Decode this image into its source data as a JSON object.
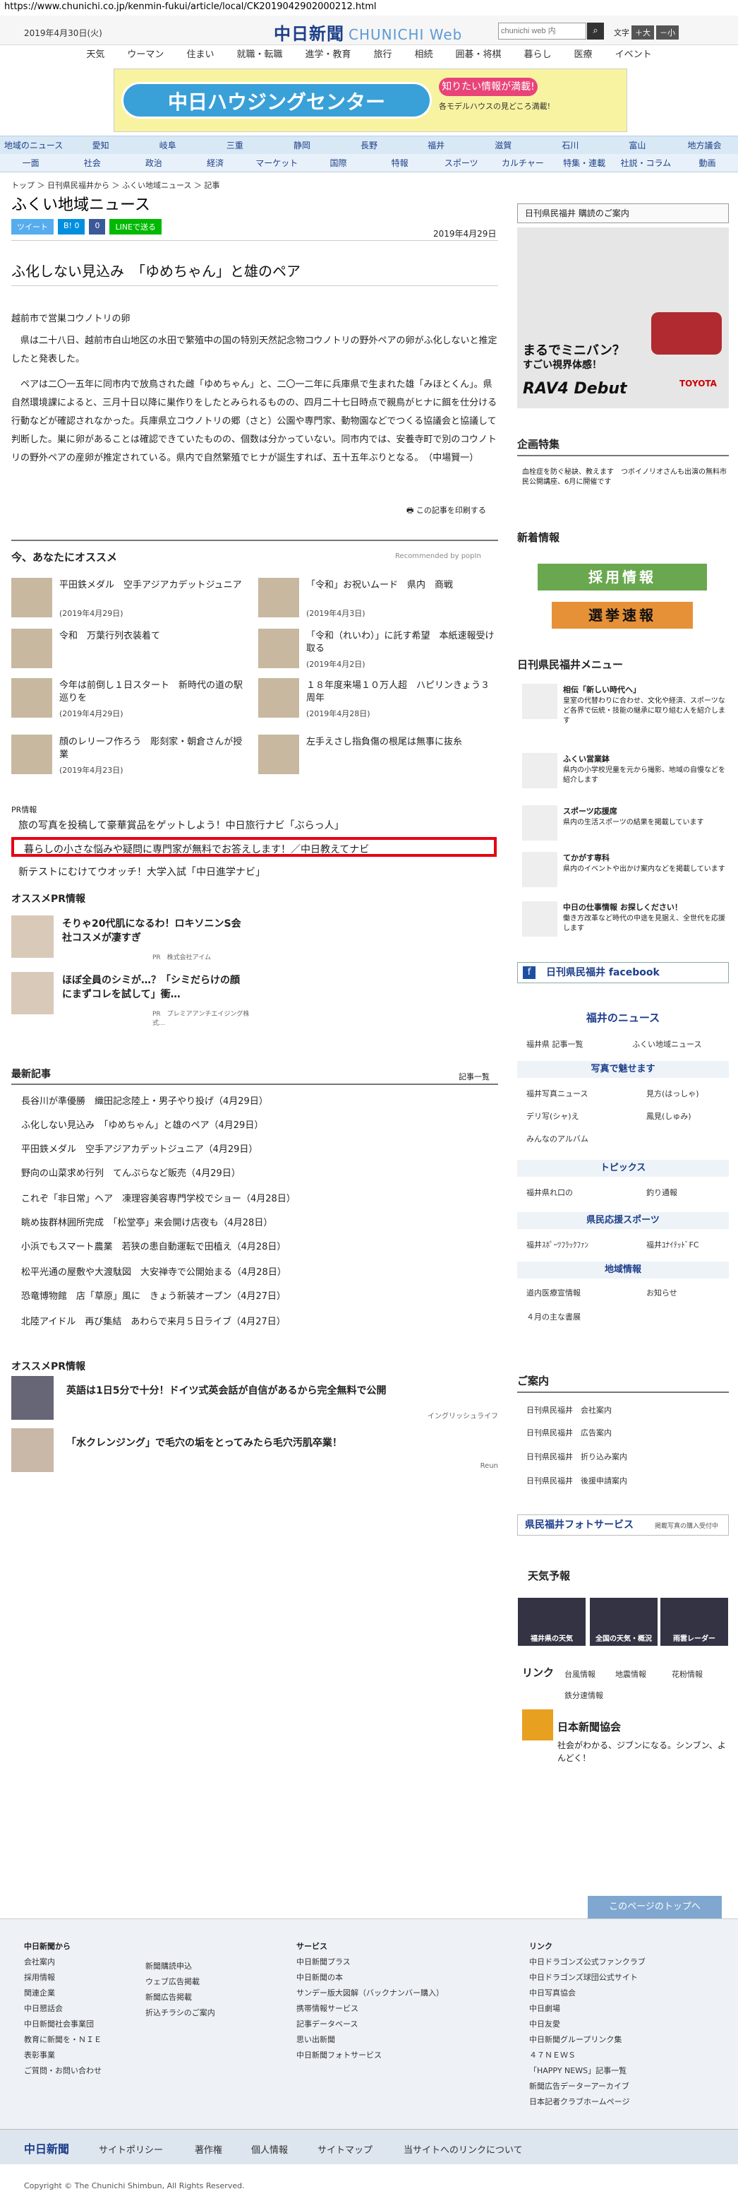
{
  "url": "https://www.chunichi.co.jp/kenmin-fukui/article/local/CK2019042902000212.html",
  "header": {
    "date": "2019年4月30日(火)",
    "logo_main": "中日新聞",
    "logo_sub": "CHUNICHI Web",
    "search_placeholder": "chunichi web 内",
    "font_label": "文字",
    "font_plus": "＋大",
    "font_minus": "－小"
  },
  "topnav": [
    "天気",
    "ウーマン",
    "住まい",
    "就職・転職",
    "進学・教育",
    "旅行",
    "相続",
    "囲碁・将棋",
    "暮らし",
    "医療",
    "イベント"
  ],
  "banner": {
    "title": "中日ハウジングセンター",
    "badge": "知りたい情報が満載!",
    "sub": "各モデルハウスの見どころ満載!"
  },
  "regions": [
    "地域のニュース",
    "愛知",
    "岐阜",
    "三重",
    "静岡",
    "長野",
    "福井",
    "滋賀",
    "石川",
    "富山",
    "地方議会"
  ],
  "categories": [
    "一面",
    "社会",
    "政治",
    "経済",
    "マーケット",
    "国際",
    "特報",
    "スポーツ",
    "カルチャー",
    "特集・連載",
    "社説・コラム",
    "動画"
  ],
  "breadcrumb": "トップ ＞ 日刊県民福井から ＞ ふくい地域ニュース ＞ 記事",
  "section_title": "ふくい地域ニュース",
  "share": {
    "tweet": "ツイート",
    "hatena": "B! 0",
    "fb": "0",
    "line": "LINEで送る"
  },
  "published": "2019年4月29日",
  "headline": "ふ化しない見込み　「ゆめちゃん」と雄のペア",
  "byline": "越前市で営巣コウノトリの卵",
  "body": [
    "県は二十八日、越前市白山地区の水田で繁殖中の国の特別天然記念物コウノトリの野外ペアの卵がふ化しないと推定したと発表した。",
    "ペアは二〇一五年に同市内で放鳥された雌「ゆめちゃん」と、二〇一二年に兵庫県で生まれた雄「みほとくん」。県自然環境課によると、三月十日以降に巣作りをしたとみられるものの、四月二十七日時点で親鳥がヒナに餌を仕分ける行動などが確認されなかった。兵庫県立コウノトリの郷（さと）公園や専門家、動物園などでつくる協議会と協議して判断した。巣に卵があることは確認できていたものの、個数は分かっていない。同市内では、安養寺町で別のコウノトリの野外ペアの産卵が推定されている。県内で自然繁殖でヒナが誕生すれば、五十五年ぶりとなる。　（中場賢一）"
  ],
  "print_link": "この記事を印刷する",
  "reco": {
    "heading": "今、あなたにオススメ",
    "powered": "Recommended by popIn",
    "items": [
      {
        "title": "平田鉄メダル　空手アジアカデットジュニア",
        "date": "(2019年4月29日)"
      },
      {
        "title": "「令和」お祝いムード　県内　商戦",
        "date": "(2019年4月3日)"
      },
      {
        "title": "令和　万葉行列衣装着て",
        "date": ""
      },
      {
        "title": "「令和（れいわ）」に託す希望　本紙速報受け取る",
        "date": "(2019年4月2日)"
      },
      {
        "title": "今年は前倒し１日スタート　新時代の道の駅巡りを",
        "date": "(2019年4月29日)"
      },
      {
        "title": "１８年度来場１０万人超　ハピリンきょう３周年",
        "date": "(2019年4月28日)"
      },
      {
        "title": "顔のレリーフ作ろう　彫刻家・朝倉さんが授業",
        "date": "(2019年4月23日)"
      },
      {
        "title": "左手えさし指負傷の根尾は無事に抜糸",
        "date": ""
      }
    ]
  },
  "pr": {
    "label": "PR情報",
    "items": [
      "旅の写真を投稿して豪華賞品をゲットしよう！中日旅行ナビ「ぶらっ人」",
      "暮らしの小さな悩みや疑問に専門家が無料でお答えします！／中日教えてナビ",
      "新テストにむけてウオッチ！大学入試「中日進学ナビ」"
    ]
  },
  "pr2": {
    "heading": "オススメPR情報",
    "items": [
      {
        "title": "そりゃ20代肌になるわ！ロキソニンS会社コスメが凄すぎ",
        "src": "PR　株式会社アイム"
      },
      {
        "title": "ほぼ全員のシミが…？「シミだらけの顔にまずコレを試して」衝…",
        "src": "PR　プレミアアンチエイジング株式…"
      }
    ]
  },
  "latest": {
    "heading": "最新記事",
    "all": "記事一覧",
    "items": [
      "長谷川が準優勝　織田記念陸上・男子やり投げ（4月29日）",
      "ふ化しない見込み　「ゆめちゃん」と雄のペア（4月29日）",
      "平田鉄メダル　空手アジアカデットジュニア（4月29日）",
      "野向の山菜求め行列　てんぷらなど販売（4月29日）",
      "これぞ「非日常」ヘア　凍理容美容専門学校でショー（4月28日）",
      "眺め抜群林囲所完成　「松堂亭」来会開け店夜も（4月28日）",
      "小浜でもスマート農業　若狭の患自動運転で田植え（4月28日）",
      "松平光通の屋敷や大渡駄図　大安禅寺で公開始まる（4月28日）",
      "恐竜博物館　店「草原」風に　きょう新装オープン（4月27日）",
      "北陸アイドル　再び集結　あわらで来月５日ライブ（4月27日）"
    ]
  },
  "pr3": {
    "heading": "オススメPR情報",
    "items": [
      {
        "title": "英語は1日5分で十分！ドイツ式英会話が自信があるから完全無料で公開",
        "src": "イングリッシュライフ"
      },
      {
        "title": "「水クレンジング」で毛穴の垢をとってみたら毛穴汚肌卒業！",
        "src": "Reun"
      }
    ]
  },
  "sidebar": {
    "subscribe": "日刊県民福井 購読のご案内",
    "ad": {
      "line1": "まるでミニバン？",
      "line2": "すごい視界体感！",
      "model": "RAV4 Debut",
      "brand": "TOYOTA"
    },
    "plan_heading": "企画特集",
    "plan_item": "血栓症を防ぐ秘訣、教えます　つボイノリオさんも出演の無料市民公開講座、6月に開催です",
    "new_heading": "新着情報",
    "new_btn1": "採用情報",
    "new_btn2": "選挙速報",
    "menu_heading": "日刊県民福井メニュー",
    "menu": [
      {
        "t": "相伝「新しい時代へ」",
        "d": "皇室の代替わりに合わせ、文化や経済、スポーツなど各界で伝統・技能の継承に取り組む人を紹介します"
      },
      {
        "t": "ふくい営業鉢",
        "d": "県内の小学校児童を元から撮影、地域の自慢などを紹介します"
      },
      {
        "t": "スポーツ応援席",
        "d": "県内の生活スポーツの結果を掲載しています"
      },
      {
        "t": "てかがす専科",
        "d": "県内のイベントや出かけ案内などを掲載しています"
      },
      {
        "t": "中日の仕事情報 お探しください！",
        "d": "働き方改革など時代の中途を見据え、全世代を応援します"
      }
    ],
    "facebook": "日刊県民福井 facebook",
    "fukui_news": "福井のニュース",
    "links1": [
      "福井県 記事一覧",
      "ふくい地域ニュース"
    ],
    "cat_photo": "写真で魅せます",
    "links2": [
      "福井写真ニュース",
      "見方(はっしゃ)",
      "デリ写(シャ)え",
      "鳳見(しゅみ)",
      "みんなのアルバム"
    ],
    "cat_topics": "トピックス",
    "links3": [
      "福井県れ口の",
      "釣り通報"
    ],
    "cat_sports": "県民応援スポーツ",
    "links4": [
      "福井ｽﾎﾟｰﾂﾌﾗｯｸﾌｧﾝ",
      "福井ﾕﾅｲﾃｯﾄﾞFC"
    ],
    "cat_region": "地域情報",
    "links5": [
      "道内医療宣情報",
      "お知らせ",
      "４月の主な書展"
    ],
    "annai_heading": "ご案内",
    "annai": [
      "日刊県民福井　会社案内",
      "日刊県民福井　広告案内",
      "日刊県民福井　折り込み案内",
      "日刊県民福井　後援申請案内"
    ],
    "photo_service": "県民福井フォトサービス",
    "photo_sub": "掲載写真の購入受付中",
    "weather_heading": "天気予報",
    "weather": [
      "福井県の天気",
      "全国の天気・概況",
      "雨雲レーダー"
    ],
    "link_heading": "リンク",
    "link_items": [
      "台風情報",
      "地震情報",
      "花粉情報",
      "鉄分速情報"
    ],
    "nsk_title": "日本新聞協会",
    "nsk_desc": "社会がわかる、ジブンになる。シンブン、よんどく！"
  },
  "to_top": "このページのトップへ",
  "footer": {
    "col1_head": "中日新聞から",
    "col1": [
      "会社案内",
      "採用情報",
      "関連企業",
      "中日懇話会",
      "中日新聞社会事業団",
      "教育に新聞を・ＮＩＥ",
      "表彰事業",
      "ご質問・お問い合わせ"
    ],
    "col2": [
      "新聞購読申込",
      "ウェブ広告掲載",
      "新聞広告掲載",
      "折込チラシのご案内"
    ],
    "col3_head": "サービス",
    "col3": [
      "中日新聞プラス",
      "中日新聞の本",
      "サンデー版大図解（バックナンバー購入）",
      "携帯情報サービス",
      "記事データベース",
      "思い出新聞",
      "中日新聞フォトサービス"
    ],
    "col4_head": "リンク",
    "col4": [
      "中日ドラゴンズ公式ファンクラブ",
      "中日ドラゴンズ球団公式サイト",
      "中日写真協会",
      "中日劇場",
      "中日友愛",
      "中日新聞グループリンク集",
      "４７ＮＥＷＳ",
      "「HAPPY NEWS」記事一覧",
      "新聞広告データーアーカイブ",
      "日本記者クラブホームページ"
    ],
    "bar_logo": "中日新聞",
    "bar_items": [
      "サイトポリシー",
      "著作権",
      "個人情報",
      "サイトマップ",
      "当サイトへのリンクについて"
    ],
    "copyright": "Copyright © The Chunichi Shimbun, All Rights Reserved."
  }
}
